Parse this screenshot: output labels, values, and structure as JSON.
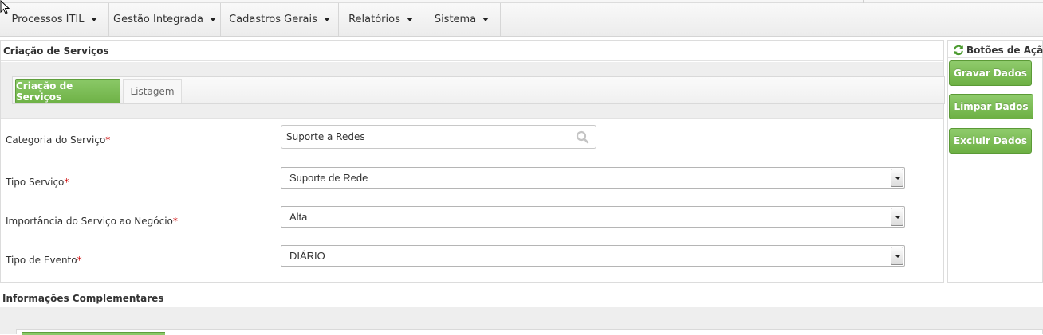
{
  "nav": {
    "items": [
      {
        "label": "Processos ITIL"
      },
      {
        "label": "Gestão Integrada"
      },
      {
        "label": "Cadastros Gerais"
      },
      {
        "label": "Relatórios"
      },
      {
        "label": "Sistema"
      }
    ]
  },
  "main": {
    "section_title": "Criação de Serviços",
    "tabs": [
      {
        "label": "Criação de Serviços",
        "active": true
      },
      {
        "label": "Listagem",
        "active": false
      }
    ],
    "fields": {
      "categoria": {
        "label": "Categoria do Serviço",
        "required": "*",
        "value": "Suporte a Redes"
      },
      "tipo": {
        "label": "Tipo Serviço",
        "required": "*",
        "value": "Suporte de Rede"
      },
      "importancia": {
        "label": "Importância do Serviço ao Negócio",
        "required": "*",
        "value": "Alta"
      },
      "evento": {
        "label": "Tipo de Evento",
        "required": "*",
        "value": "DIÁRIO"
      }
    }
  },
  "actions": {
    "title": "Botões de Ação",
    "buttons": [
      {
        "label": "Gravar Dados"
      },
      {
        "label": "Limpar Dados"
      },
      {
        "label": "Excluir Dados"
      }
    ]
  },
  "bottom": {
    "section_title": "Informações Complementares"
  },
  "colors": {
    "accent_green": "#6fb247",
    "required_red": "#cc0000"
  },
  "icons": {
    "search": "search-icon",
    "refresh": "refresh-icon",
    "cursor": "mouse-pointer-icon"
  }
}
